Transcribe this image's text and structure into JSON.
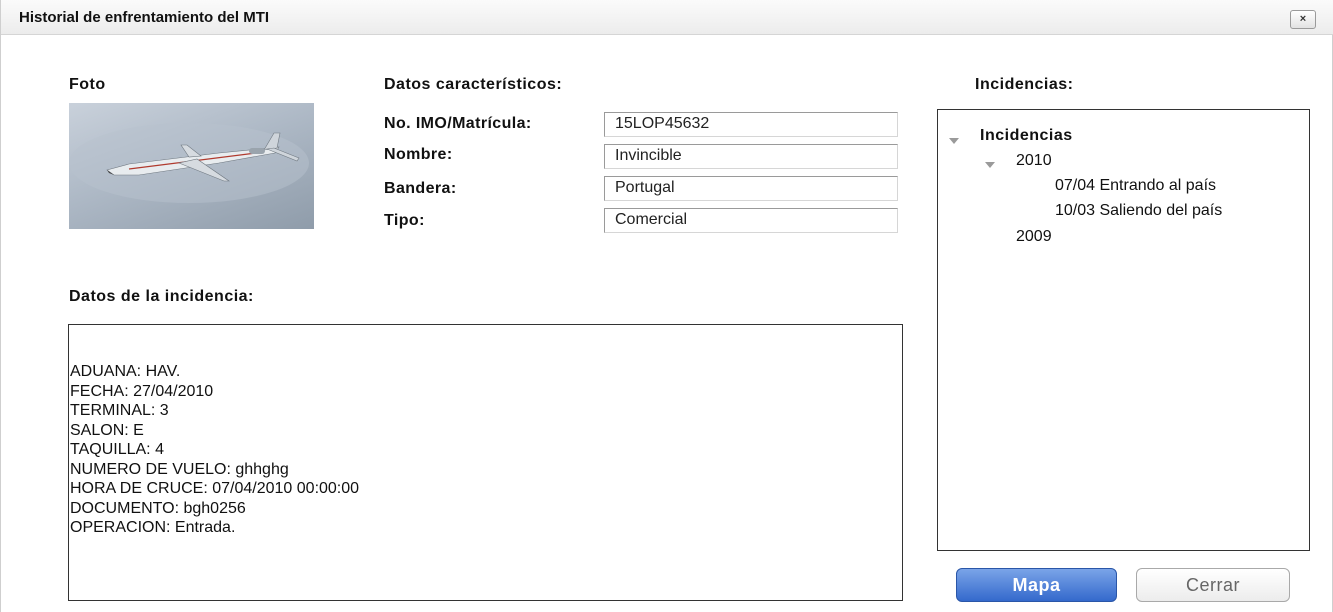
{
  "window": {
    "title": "Historial de enfrentamiento del MTI",
    "close_symbol": "×"
  },
  "photo": {
    "label": "Foto",
    "image": "airplane-photo"
  },
  "caracteristicos": {
    "heading": "Datos característicos:",
    "fields": [
      {
        "label": "No. IMO/Matrícula:",
        "value": "15LOP45632"
      },
      {
        "label": "Nombre:",
        "value": "Invincible"
      },
      {
        "label": "Bandera:",
        "value": "Portugal"
      },
      {
        "label": "Tipo:",
        "value": "Comercial"
      }
    ]
  },
  "incidencia": {
    "heading": "Datos de la incidencia:",
    "lines": [
      "ADUANA: HAV.",
      "FECHA: 27/04/2010",
      "TERMINAL: 3",
      "SALON: E",
      "TAQUILLA: 4",
      "NUMERO DE VUELO: ghhghg",
      "HORA DE CRUCE: 07/04/2010 00:00:00",
      "DOCUMENTO: bgh0256",
      "OPERACION: Entrada."
    ]
  },
  "incidencias": {
    "heading": "Incidencias:",
    "tree": {
      "root": "Incidencias",
      "year_2010": "2010",
      "entries_2010": [
        "07/04 Entrando al país",
        "10/03 Saliendo del país"
      ],
      "year_2009": "2009"
    }
  },
  "buttons": {
    "mapa": "Mapa",
    "cerrar": "Cerrar"
  },
  "colors": {
    "primary_button": "#3469cc",
    "tree_arrow": "#9a9a9a"
  }
}
